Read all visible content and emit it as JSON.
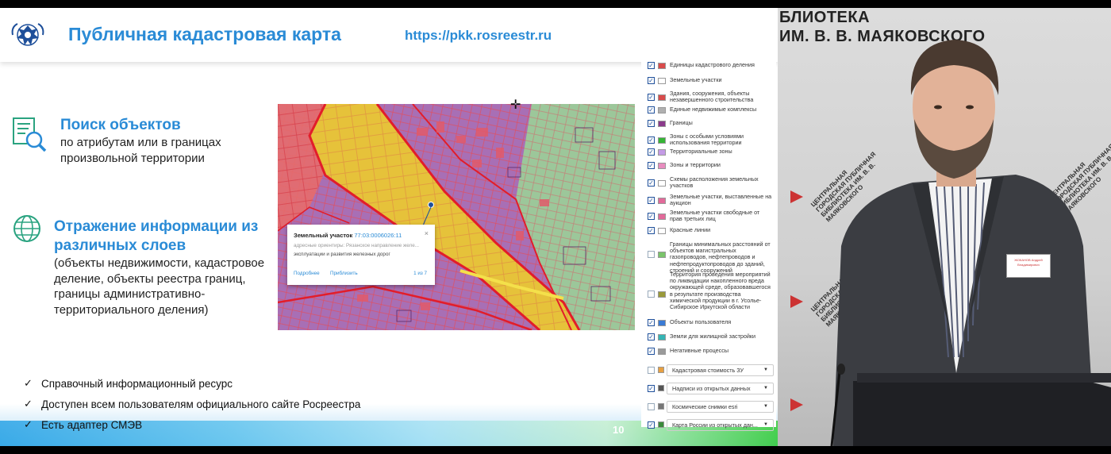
{
  "slide": {
    "title": "Публичная кадастровая карта",
    "url": "https://pkk.rosreestr.ru",
    "page_number": "10",
    "features": [
      {
        "title": "Поиск объектов",
        "text": "по атрибутам или в границах произвольной территории",
        "icon": "search-document-icon"
      },
      {
        "title": "Отражение информации из различных слоев",
        "text": "(объекты недвижимости, кадастровое деление, объекты реестра границ, границы административно-территориального деления)",
        "icon": "globe-icon"
      }
    ],
    "checklist": [
      "Справочный информационный ресурс",
      "Доступен всем пользователям официального сайте Росреестра",
      "Есть адаптер СМЭВ"
    ],
    "colors": {
      "accent": "#2a8bd6",
      "map_purple": "#a86fb5",
      "map_red": "#e25a5a",
      "map_yellow": "#e6c23a",
      "map_green": "#9cc79a"
    }
  },
  "map": {
    "popup": {
      "title": "Земельный участок",
      "number": "77:03:0006026:11",
      "address": "адресные ориентиры: Рязанское направление желе...",
      "use": "эксплуатации и развития железных дорог",
      "more": "Подробнее",
      "zoom": "Приблизить",
      "page": "1 из 7",
      "close": "×"
    }
  },
  "layers": [
    {
      "label": "Единицы кадастрового деления",
      "checked": true,
      "swatch": "#d94b4b"
    },
    {
      "label": "Земельные участки",
      "checked": true,
      "swatch": "#ffffff"
    },
    {
      "label": "Здания, сооружения, объекты незавершенного строительства",
      "checked": true,
      "swatch": "#d94b4b"
    },
    {
      "label": "Единые недвижимые комплексы",
      "checked": true,
      "swatch": "#b0b0b0"
    },
    {
      "label": "Границы",
      "checked": true,
      "swatch": "#8b3a8b"
    },
    {
      "label": "Зоны с особыми условиями использования территории",
      "checked": true,
      "swatch": "#35b535"
    },
    {
      "label": "Территориальные зоны",
      "checked": true,
      "swatch": "#c49be6"
    },
    {
      "label": "Зоны и территории",
      "checked": true,
      "swatch": "#e88cbf"
    },
    {
      "label": "Схемы расположения земельных участков",
      "checked": true,
      "swatch": "#ffffff"
    },
    {
      "label": "Земельные участки, выставленные на аукцион",
      "checked": true,
      "swatch": "#e26a9a"
    },
    {
      "label": "Земельные участки свободные от прав третьих лиц",
      "checked": true,
      "swatch": "#e26a9a"
    },
    {
      "label": "Красные линии",
      "checked": true,
      "swatch": "#ffffff"
    },
    {
      "label": "Границы минимальных расстояний от объектов магистральных газопроводов, нефтепроводов и нефтепродуктопроводов до зданий, строений и сооружений",
      "checked": false,
      "swatch": "#7ac46a"
    },
    {
      "label": "Территория проведения мероприятий по ликвидации накопленного вреда окружающей среде, образовавшегося в результате производства химической продукции в г. Усолье-Сибирское Иркутской области",
      "checked": false,
      "swatch": "#9a9a3a"
    },
    {
      "label": "Объекты пользователя",
      "checked": true,
      "swatch": "#3a7bd5"
    },
    {
      "label": "Земли для жилищной застройки",
      "checked": true,
      "swatch": "#35b5b5"
    },
    {
      "label": "Негативные процессы",
      "checked": true,
      "swatch": "#9a9a9a"
    }
  ],
  "layer_selects": [
    {
      "label": "Кадастровая стоимость ЗУ",
      "checked": false,
      "swatch": "#e8a040"
    },
    {
      "label": "Надписи из открытых данных",
      "checked": true,
      "swatch": "#555555"
    },
    {
      "label": "Космические снимки esri",
      "checked": false,
      "swatch": "#777777"
    },
    {
      "label": "Карта России из открытых дан...",
      "checked": true,
      "swatch": "#3a8a3a"
    }
  ],
  "camera": {
    "banner_line1": "БЛИОТЕКА",
    "banner_line2": "ИМ. В. В. МАЯКОВСКОГО",
    "wall_logo": "ЦЕНТРАЛЬНАЯ ГОРОДСКАЯ ПУБЛИЧНАЯ БИБЛИОТЕКА ИМ. В. В. МАЯКОВСКОГО",
    "badge": "ЖОКАНОВ Андрей Владимирович"
  }
}
